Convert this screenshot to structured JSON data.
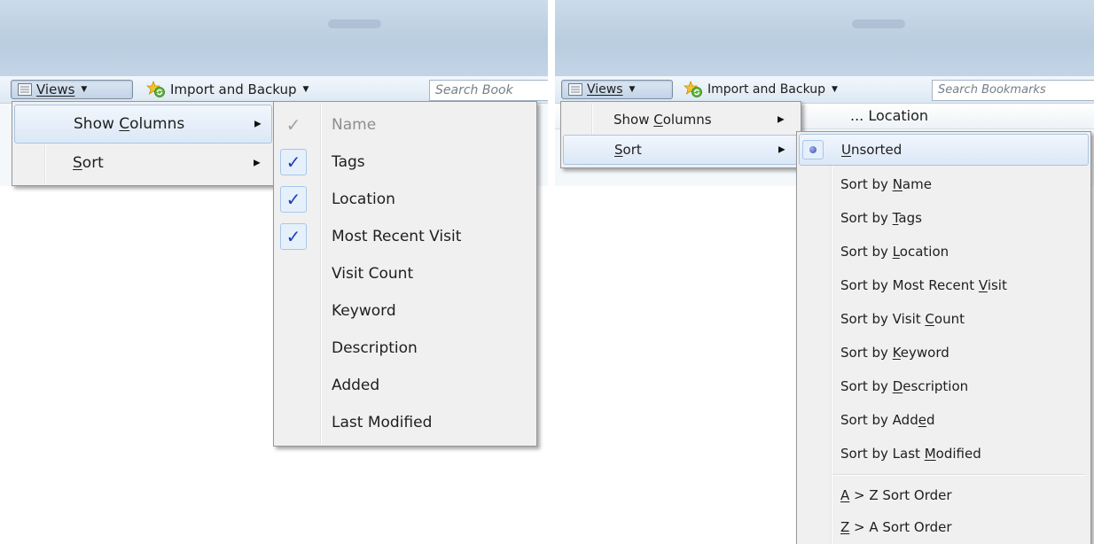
{
  "left_panel": {
    "toolbar": {
      "views_label": "Views",
      "import_label": "Import and Backup",
      "search_placeholder": "Search Book"
    },
    "views_menu": {
      "items": [
        {
          "label": "Show Columns",
          "accel_index": 5,
          "has_submenu": true,
          "highlighted": true
        },
        {
          "label": "Sort",
          "accel_index": 0,
          "has_submenu": true,
          "highlighted": false
        }
      ]
    },
    "columns_submenu": {
      "items": [
        {
          "label": "Name",
          "checked": true,
          "disabled": true
        },
        {
          "label": "Tags",
          "checked": true,
          "disabled": false
        },
        {
          "label": "Location",
          "checked": true,
          "disabled": false
        },
        {
          "label": "Most Recent Visit",
          "checked": true,
          "disabled": false
        },
        {
          "label": "Visit Count",
          "checked": false,
          "disabled": false
        },
        {
          "label": "Keyword",
          "checked": false,
          "disabled": false
        },
        {
          "label": "Description",
          "checked": false,
          "disabled": false
        },
        {
          "label": "Added",
          "checked": false,
          "disabled": false
        },
        {
          "label": "Last Modified",
          "checked": false,
          "disabled": false
        }
      ]
    }
  },
  "right_panel": {
    "toolbar": {
      "views_label": "Views",
      "import_label": "Import and Backup",
      "search_placeholder": "Search Bookmarks"
    },
    "column_header": "... Location",
    "views_menu": {
      "items": [
        {
          "label": "Show Columns",
          "accel_index": 5,
          "has_submenu": true,
          "highlighted": false
        },
        {
          "label": "Sort",
          "accel_index": 0,
          "has_submenu": true,
          "highlighted": true
        }
      ]
    },
    "sort_submenu": {
      "items": [
        {
          "label": "Unsorted",
          "accel_index": 0,
          "selected": true,
          "highlighted": true
        },
        {
          "label": "Sort by Name",
          "accel_index": 8
        },
        {
          "label": "Sort by Tags",
          "accel_index": 8
        },
        {
          "label": "Sort by Location",
          "accel_index": 8
        },
        {
          "label": "Sort by Most Recent Visit",
          "accel_index": 20
        },
        {
          "label": "Sort by Visit Count",
          "accel_index": 14
        },
        {
          "label": "Sort by Keyword",
          "accel_index": 8
        },
        {
          "label": "Sort by Description",
          "accel_index": 8
        },
        {
          "label": "Sort by Added",
          "accel_index": 11
        },
        {
          "label": "Sort by Last Modified",
          "accel_index": 13
        }
      ],
      "order_items": [
        {
          "label": "A > Z Sort Order",
          "accel_index": 0
        },
        {
          "label": "Z > A Sort Order",
          "accel_index": 0
        }
      ]
    }
  },
  "colors": {
    "check_mark": "#1c3fb5",
    "highlight_border": "#a9c4e3",
    "menu_background": "#f0f0f0",
    "title_bar": "#c3d4e6"
  },
  "icons": {
    "views": "list-view-icon",
    "import_backup": "star-sync-icon",
    "dropdown": "caret-down-icon",
    "submenu": "submenu-arrow-icon",
    "check": "check-icon",
    "radio": "radio-dot-icon"
  }
}
